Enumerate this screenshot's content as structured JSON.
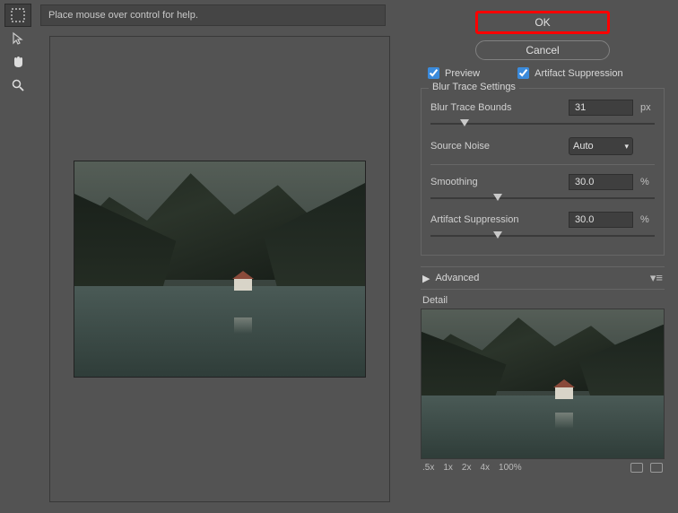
{
  "help_text": "Place mouse over control for help.",
  "buttons": {
    "ok": "OK",
    "cancel": "Cancel"
  },
  "checks": {
    "preview": "Preview",
    "artifact": "Artifact Suppression"
  },
  "blur_trace": {
    "legend": "Blur Trace Settings",
    "bounds_label": "Blur Trace Bounds",
    "bounds_value": "31",
    "bounds_unit": "px",
    "noise_label": "Source Noise",
    "noise_value": "Auto",
    "smoothing_label": "Smoothing",
    "smoothing_value": "30.0",
    "smoothing_unit": "%",
    "artifact_label": "Artifact Suppression",
    "artifact_value": "30.0",
    "artifact_unit": "%"
  },
  "advanced_label": "Advanced",
  "detail_label": "Detail",
  "zoom": {
    "z05": ".5x",
    "z1": "1x",
    "z2": "2x",
    "z4": "4x",
    "z100": "100%"
  },
  "tools": {
    "marquee": "marquee-tool",
    "arrow": "direct-select-tool",
    "hand": "hand-tool",
    "zoom": "zoom-tool"
  }
}
